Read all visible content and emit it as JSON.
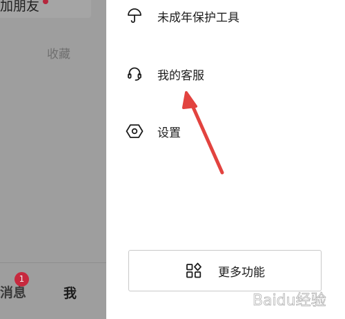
{
  "background": {
    "add_friends_label": "加朋友",
    "favorites_label": "收藏",
    "bottom_nav": {
      "messages_label": "消息",
      "messages_badge": "1",
      "me_label": "我"
    }
  },
  "drawer": {
    "items": [
      {
        "label": "未成年保护工具",
        "icon": "umbrella-icon"
      },
      {
        "label": "我的客服",
        "icon": "headset-icon"
      },
      {
        "label": "设置",
        "icon": "settings-hexagon-icon"
      }
    ],
    "more_button": {
      "label": "更多功能",
      "icon": "grid-more-icon"
    }
  },
  "annotation": {
    "color": "#e2433f",
    "type": "arrow"
  },
  "watermark": {
    "text": "Baidu经验"
  },
  "colors": {
    "overlay_gray": "#9e9e9e",
    "badge_red": "#c7293e",
    "drawer_bg": "#ffffff",
    "text_dark": "#1c1c1c"
  }
}
